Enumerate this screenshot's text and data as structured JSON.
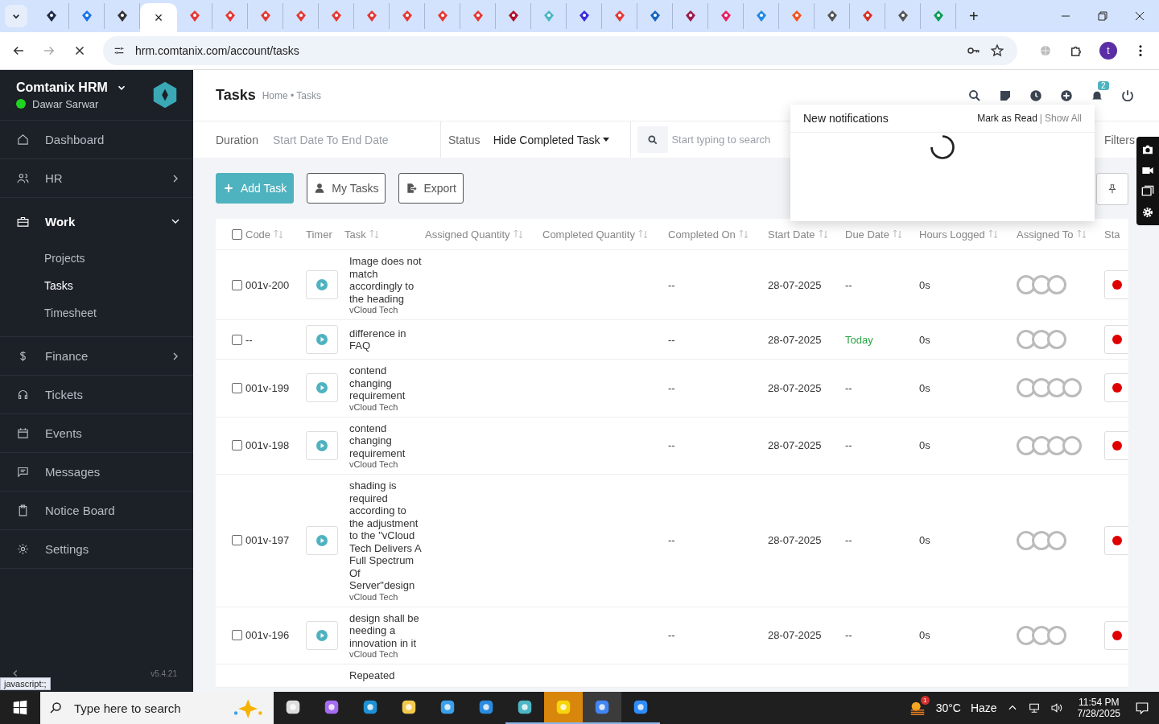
{
  "browser": {
    "tabs": [
      {
        "selected": false
      },
      {
        "selected": false
      },
      {
        "selected": false
      },
      {
        "selected": true
      },
      {
        "selected": false
      },
      {
        "selected": false
      },
      {
        "selected": false
      },
      {
        "selected": false
      },
      {
        "selected": false
      },
      {
        "selected": false
      },
      {
        "selected": false
      },
      {
        "selected": false
      },
      {
        "selected": false
      },
      {
        "selected": false
      },
      {
        "selected": false
      },
      {
        "selected": false
      },
      {
        "selected": false
      },
      {
        "selected": false
      },
      {
        "selected": false
      },
      {
        "selected": false
      },
      {
        "selected": false
      },
      {
        "selected": false
      },
      {
        "selected": false
      },
      {
        "selected": false
      },
      {
        "selected": false
      },
      {
        "selected": false
      }
    ],
    "close": "×",
    "new_tab": "+",
    "url": "hrm.comtanix.com/account/tasks",
    "profile": "t"
  },
  "sidebar": {
    "brand": "Comtanix HRM",
    "user": "Dawar Sarwar",
    "online": true,
    "version": "v5.4.21",
    "items": [
      {
        "label": "Dashboard",
        "selected": false,
        "expandable": false,
        "expanded": false
      },
      {
        "label": "HR",
        "selected": false,
        "expandable": true,
        "expanded": false
      },
      {
        "label": "Work",
        "selected": false,
        "expandable": true,
        "expanded": true,
        "children": [
          {
            "label": "Projects",
            "selected": false
          },
          {
            "label": "Tasks",
            "selected": true
          },
          {
            "label": "Timesheet",
            "selected": false
          }
        ]
      },
      {
        "label": "Finance",
        "selected": false,
        "expandable": true,
        "expanded": false
      },
      {
        "label": "Tickets",
        "selected": false,
        "expandable": false,
        "expanded": false
      },
      {
        "label": "Events",
        "selected": false,
        "expandable": false,
        "expanded": false
      },
      {
        "label": "Messages",
        "selected": false,
        "expandable": false,
        "expanded": false
      },
      {
        "label": "Notice Board",
        "selected": false,
        "expandable": false,
        "expanded": false
      },
      {
        "label": "Settings",
        "selected": false,
        "expandable": false,
        "expanded": false
      }
    ]
  },
  "header": {
    "title": "Tasks",
    "breadcrumb": "Home • Tasks",
    "notification_count": "2"
  },
  "filters": {
    "duration_label": "Duration",
    "duration_placeholder": "Start Date To End Date",
    "status_label": "Status",
    "status_value": "Hide Completed Task",
    "search_placeholder": "Start typing to search",
    "more": "Filters"
  },
  "actions": [
    "Add Task",
    "My Tasks",
    "Export"
  ],
  "notifications": {
    "title": "New notifications",
    "mark_read": "Mark as Read",
    "separator": "|",
    "show_all": "Show All",
    "loading": true
  },
  "table": {
    "columns": [
      {
        "label": "Code",
        "sortable": true
      },
      {
        "label": "Timer",
        "sortable": false
      },
      {
        "label": "Task",
        "sortable": true
      },
      {
        "label": "Assigned Quantity",
        "sortable": true
      },
      {
        "label": "Completed Quantity",
        "sortable": true
      },
      {
        "label": "Completed On",
        "sortable": true
      },
      {
        "label": "Start Date",
        "sortable": true
      },
      {
        "label": "Due Date",
        "sortable": true
      },
      {
        "label": "Hours Logged",
        "sortable": true
      },
      {
        "label": "Assigned To",
        "sortable": true
      },
      {
        "label": "Sta",
        "sortable": false
      }
    ],
    "rows": [
      {
        "checked": false,
        "code": "001v-200",
        "task": "Image does not match accordingly to the heading",
        "project": "vCloud Tech",
        "completed_on": "--",
        "start": "28-07-2025",
        "due": "--",
        "due_today": false,
        "hours": "0s",
        "assignees": [
          {
            "kind": "avatar"
          },
          {
            "kind": "avatar"
          },
          {
            "kind": "avatar"
          }
        ],
        "status": {
          "color": "#e00000"
        }
      },
      {
        "checked": false,
        "code": "--",
        "task": "difference in FAQ",
        "completed_on": "--",
        "start": "28-07-2025",
        "due": "Today",
        "due_today": true,
        "hours": "0s",
        "assignees": [
          {
            "kind": "avatar"
          },
          {
            "kind": "avatar"
          },
          {
            "kind": "avatar"
          }
        ],
        "status": {
          "color": "#e00000"
        }
      },
      {
        "checked": false,
        "code": "001v-199",
        "task": "contend changing requirement",
        "project": "vCloud Tech",
        "completed_on": "--",
        "start": "28-07-2025",
        "due": "--",
        "due_today": false,
        "hours": "0s",
        "assignees": [
          {
            "kind": "avatar"
          },
          {
            "kind": "avatar"
          },
          {
            "kind": "avatar"
          },
          {
            "kind": "avatar"
          }
        ],
        "status": {
          "color": "#e00000"
        }
      },
      {
        "checked": false,
        "code": "001v-198",
        "task": "contend changing requirement",
        "project": "vCloud Tech",
        "completed_on": "--",
        "start": "28-07-2025",
        "due": "--",
        "due_today": false,
        "hours": "0s",
        "assignees": [
          {
            "kind": "avatar"
          },
          {
            "kind": "avatar"
          },
          {
            "kind": "avatar"
          },
          {
            "kind": "avatar"
          }
        ],
        "status": {
          "color": "#e00000"
        }
      },
      {
        "checked": false,
        "code": "001v-197",
        "task": "shading is required according to the adjustment to the \"vCloud Tech Delivers A Full Spectrum Of Server\"design",
        "project": "vCloud Tech",
        "completed_on": "--",
        "start": "28-07-2025",
        "due": "--",
        "due_today": false,
        "hours": "0s",
        "assignees": [
          {
            "kind": "avatar"
          },
          {
            "kind": "avatar"
          },
          {
            "kind": "avatar"
          }
        ],
        "status": {
          "color": "#e00000"
        }
      },
      {
        "checked": false,
        "code": "001v-196",
        "task": "design shall be needing a innovation in it",
        "project": "vCloud Tech",
        "completed_on": "--",
        "start": "28-07-2025",
        "due": "--",
        "due_today": false,
        "hours": "0s",
        "assignees": [
          {
            "kind": "avatar"
          },
          {
            "kind": "avatar"
          },
          {
            "kind": "avatar"
          }
        ],
        "status": {
          "color": "#e00000"
        }
      },
      {
        "task": "Repeated"
      }
    ],
    "all_selected": false
  },
  "status_tooltip": "javascript:;",
  "taskbar": {
    "search_placeholder": "Type here to search",
    "apps": [
      {
        "running": false,
        "selected": false
      },
      {
        "running": false,
        "selected": false
      },
      {
        "running": false,
        "selected": false
      },
      {
        "running": false,
        "selected": false
      },
      {
        "running": false,
        "selected": false
      },
      {
        "running": false,
        "selected": false
      },
      {
        "running": true,
        "selected": false
      },
      {
        "running": true,
        "selected": false
      },
      {
        "running": true,
        "selected": true
      },
      {
        "running": true,
        "selected": false
      }
    ],
    "weather_badge": "1",
    "temperature": "30°C",
    "condition": "Haze",
    "time": "11:54 PM",
    "date": "7/28/2025"
  }
}
